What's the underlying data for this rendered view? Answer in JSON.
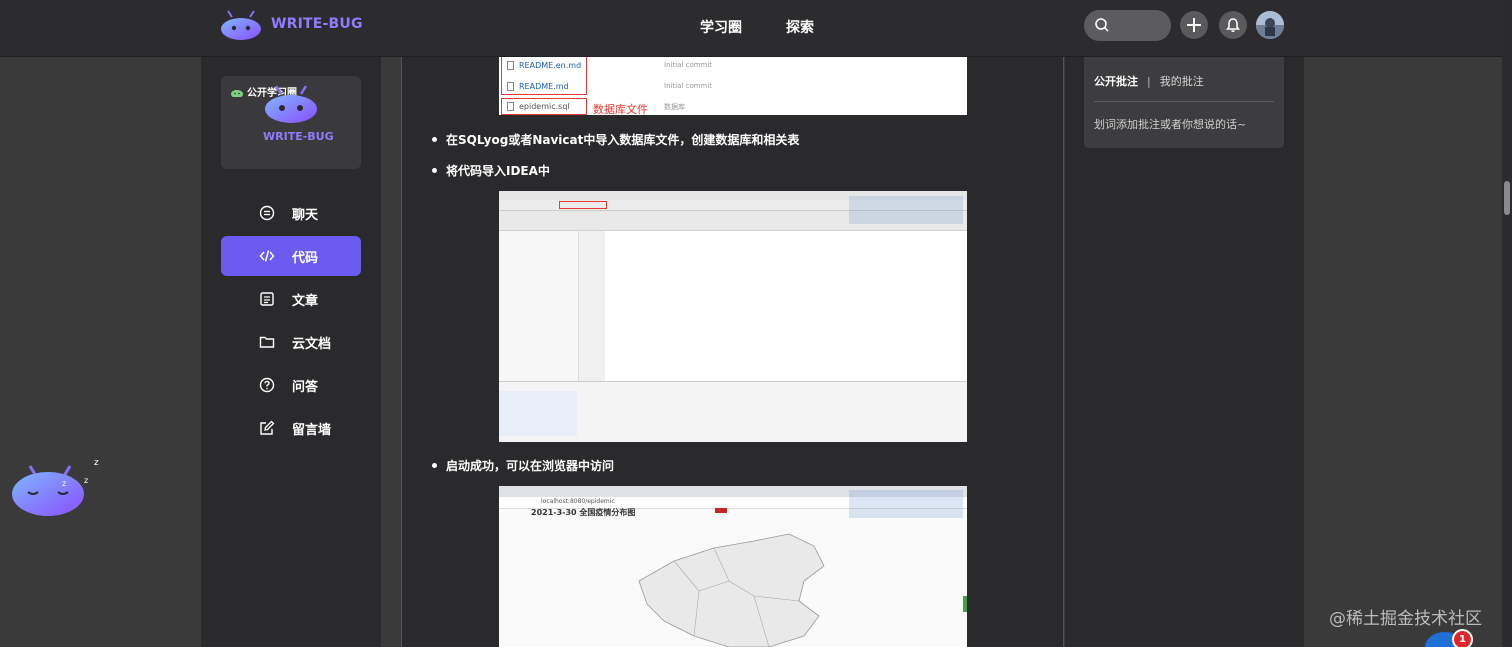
{
  "brand": {
    "name": "WRITE-BUG"
  },
  "nav": {
    "study_circle": "学习圈",
    "explore": "探索"
  },
  "sidebar": {
    "circle_badge": "公开学习圈",
    "circle_brand": "WRITE-BUG",
    "items": [
      {
        "label": "聊天",
        "icon": "chat-icon"
      },
      {
        "label": "代码",
        "icon": "code-icon",
        "active": true
      },
      {
        "label": "文章",
        "icon": "article-icon"
      },
      {
        "label": "云文档",
        "icon": "folder-icon"
      },
      {
        "label": "问答",
        "icon": "question-icon"
      },
      {
        "label": "留言墙",
        "icon": "edit-icon"
      }
    ]
  },
  "content": {
    "files": [
      {
        "name": "README.en.md",
        "commit": "Initial commit"
      },
      {
        "name": "README.md",
        "commit": "Initial commit"
      },
      {
        "name": "epidemic.sql",
        "commit": "数据库"
      }
    ],
    "db_file_note": "数据库文件",
    "bullets": [
      "在SQLyog或者Navicat中导入数据库文件，创建数据库和相关表",
      "将代码导入IDEA中",
      "启动成功，可以在浏览器中访问"
    ],
    "map_title": "2021-3-30 全国疫情分布图",
    "browser_url": "localhost:8080/epidemic"
  },
  "annotations": {
    "tab_public": "公开批注",
    "separator": "|",
    "tab_mine": "我的批注",
    "hint": "划词添加批注或者你想说的话~"
  },
  "watermark": "@稀土掘金技术社区",
  "notification_count": "1",
  "colors": {
    "accent": "#6c5bf1",
    "brand_text": "#8f7cff",
    "badge_red": "#e0262a"
  }
}
